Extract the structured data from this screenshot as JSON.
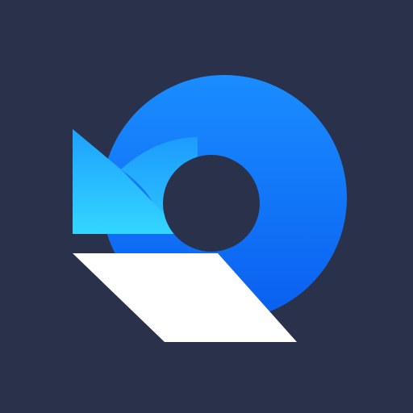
{
  "app_icon": {
    "icon_name": "restore-recovery-logo-icon",
    "colors": {
      "background": "#2a324b",
      "ring_top": "#1a8dff",
      "ring_bottom": "#0a5ff0",
      "arrow_light": "#33d6ff",
      "arrow_mid": "#1ea0ff",
      "base_shape": "#ffffff",
      "hole": "#2a324b"
    }
  }
}
